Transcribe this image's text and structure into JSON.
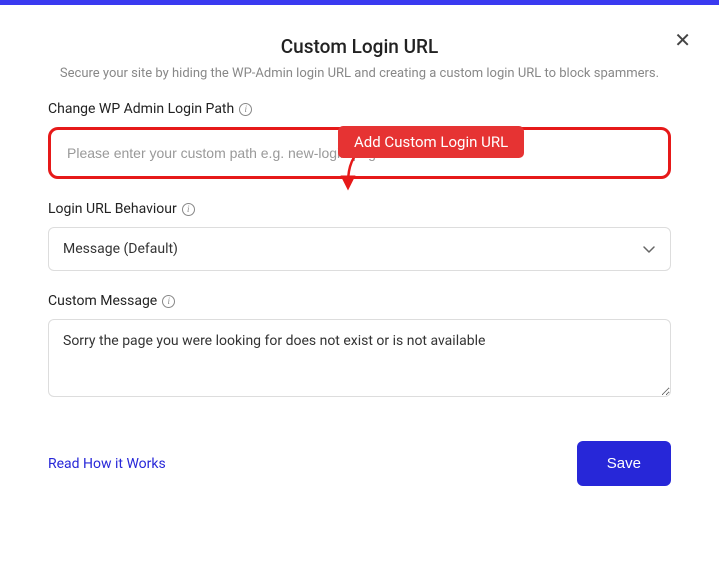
{
  "header": {
    "title": "Custom Login URL",
    "subtitle": "Secure your site by hiding the WP-Admin login URL and creating a custom login URL to block spammers."
  },
  "callout": {
    "text": "Add Custom Login URL"
  },
  "fields": {
    "login_path": {
      "label": "Change WP Admin Login Path",
      "placeholder": "Please enter your custom path e.g. new-login-page",
      "value": ""
    },
    "behaviour": {
      "label": "Login URL Behaviour",
      "selected": "Message (Default)"
    },
    "custom_message": {
      "label": "Custom Message",
      "value": "Sorry the page you were looking for does not exist or is not available"
    }
  },
  "footer": {
    "help_link": "Read How it Works",
    "save_label": "Save"
  },
  "icons": {
    "close": "✕",
    "info": "i"
  }
}
